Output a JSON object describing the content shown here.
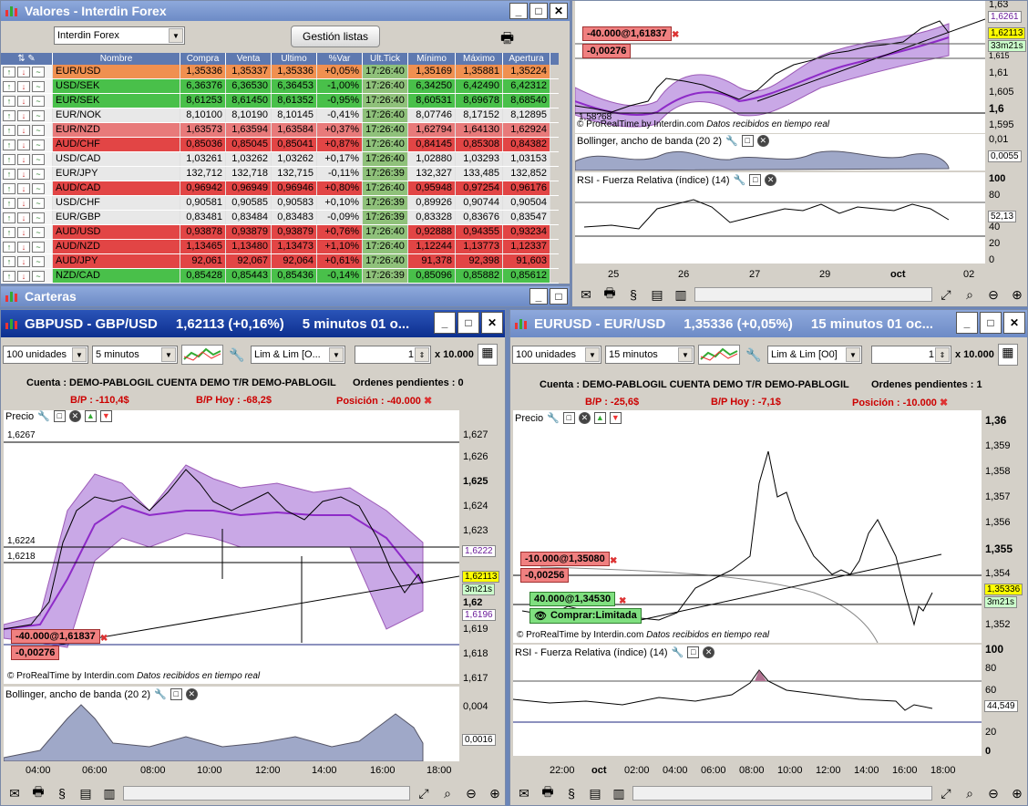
{
  "valores": {
    "title": "Valores - Interdin Forex",
    "list_select": "Interdin Forex",
    "manage_lists": "Gestión listas",
    "columns": [
      "Nombre",
      "Compra",
      "Venta",
      "Ultimo",
      "%Var",
      "Ult.Tick",
      "Mínimo",
      "Máximo",
      "Apertura"
    ],
    "rows": [
      {
        "name": "EUR/USD",
        "compra": "1,35336",
        "venta": "1,35337",
        "ultimo": "1,35336",
        "var": "+0,05%",
        "tick": "17:26:40",
        "min": "1,35169",
        "max": "1,35881",
        "ap": "1,35224",
        "color": "orange"
      },
      {
        "name": "USD/SEK",
        "compra": "6,36376",
        "venta": "6,36530",
        "ultimo": "6,36453",
        "var": "-1,00%",
        "tick": "17:26:40",
        "min": "6,34250",
        "max": "6,42490",
        "ap": "6,42312",
        "color": "green"
      },
      {
        "name": "EUR/SEK",
        "compra": "8,61253",
        "venta": "8,61450",
        "ultimo": "8,61352",
        "var": "-0,95%",
        "tick": "17:26:40",
        "min": "8,60531",
        "max": "8,69678",
        "ap": "8,68540",
        "color": "green"
      },
      {
        "name": "EUR/NOK",
        "compra": "8,10100",
        "venta": "8,10190",
        "ultimo": "8,10145",
        "var": "-0,41%",
        "tick": "17:26:40",
        "min": "8,07746",
        "max": "8,17152",
        "ap": "8,12895",
        "color": "light"
      },
      {
        "name": "EUR/NZD",
        "compra": "1,63573",
        "venta": "1,63594",
        "ultimo": "1,63584",
        "var": "+0,37%",
        "tick": "17:26:40",
        "min": "1,62794",
        "max": "1,64130",
        "ap": "1,62924",
        "color": "pink"
      },
      {
        "name": "AUD/CHF",
        "compra": "0,85036",
        "venta": "0,85045",
        "ultimo": "0,85041",
        "var": "+0,87%",
        "tick": "17:26:40",
        "min": "0,84145",
        "max": "0,85308",
        "ap": "0,84382",
        "color": "red"
      },
      {
        "name": "USD/CAD",
        "compra": "1,03261",
        "venta": "1,03262",
        "ultimo": "1,03262",
        "var": "+0,17%",
        "tick": "17:26:40",
        "min": "1,02880",
        "max": "1,03293",
        "ap": "1,03153",
        "color": "light"
      },
      {
        "name": "EUR/JPY",
        "compra": "132,712",
        "venta": "132,718",
        "ultimo": "132,715",
        "var": "-0,11%",
        "tick": "17:26:39",
        "min": "132,327",
        "max": "133,485",
        "ap": "132,852",
        "color": "light"
      },
      {
        "name": "AUD/CAD",
        "compra": "0,96942",
        "venta": "0,96949",
        "ultimo": "0,96946",
        "var": "+0,80%",
        "tick": "17:26:40",
        "min": "0,95948",
        "max": "0,97254",
        "ap": "0,96176",
        "color": "red"
      },
      {
        "name": "USD/CHF",
        "compra": "0,90581",
        "venta": "0,90585",
        "ultimo": "0,90583",
        "var": "+0,10%",
        "tick": "17:26:39",
        "min": "0,89926",
        "max": "0,90744",
        "ap": "0,90504",
        "color": "light"
      },
      {
        "name": "EUR/GBP",
        "compra": "0,83481",
        "venta": "0,83484",
        "ultimo": "0,83483",
        "var": "-0,09%",
        "tick": "17:26:39",
        "min": "0,83328",
        "max": "0,83676",
        "ap": "0,83547",
        "color": "light"
      },
      {
        "name": "AUD/USD",
        "compra": "0,93878",
        "venta": "0,93879",
        "ultimo": "0,93879",
        "var": "+0,76%",
        "tick": "17:26:40",
        "min": "0,92888",
        "max": "0,94355",
        "ap": "0,93234",
        "color": "red"
      },
      {
        "name": "AUD/NZD",
        "compra": "1,13465",
        "venta": "1,13480",
        "ultimo": "1,13473",
        "var": "+1,10%",
        "tick": "17:26:40",
        "min": "1,12244",
        "max": "1,13773",
        "ap": "1,12337",
        "color": "red"
      },
      {
        "name": "AUD/JPY",
        "compra": "92,061",
        "venta": "92,067",
        "ultimo": "92,064",
        "var": "+0,61%",
        "tick": "17:26:40",
        "min": "91,378",
        "max": "92,398",
        "ap": "91,603",
        "color": "red"
      },
      {
        "name": "NZD/CAD",
        "compra": "0,85428",
        "venta": "0,85443",
        "ultimo": "0,85436",
        "var": "-0,14%",
        "tick": "17:26:39",
        "min": "0,85096",
        "max": "0,85882",
        "ap": "0,85612",
        "color": "green"
      }
    ]
  },
  "carteras": {
    "title": "Carteras"
  },
  "topchart": {
    "order_label": "-40.000@1,61837",
    "order_value": "-0,00276",
    "prices": [
      "1,63",
      "1,6261",
      "1,62113",
      "33m21s",
      "1,615",
      "1,61",
      "1,605",
      "1,6",
      "1,595",
      "0,01",
      "0,0055",
      "100",
      "80",
      "52,13",
      "40",
      "20",
      "0"
    ],
    "credit": "© ProRealTime by Interdin.com",
    "received": "Datos recibidos en tiempo real",
    "boll_label": "Bollinger, ancho de banda (20 2)",
    "rsi_label": "RSI - Fuerza Relativa (índice) (14)",
    "xlabels": [
      "25",
      "26",
      "27",
      "29",
      "oct",
      "02"
    ],
    "low_label": "1,58?68"
  },
  "gbp": {
    "title": "GBPUSD - GBP/USD",
    "price": "1,62113 (+0,16%)",
    "period": "5 minutos  01 o...",
    "units": "100 unidades",
    "interval": "5 minutos",
    "mode": "Lim & Lim [O...",
    "qty": "1",
    "mult": "x 10.000",
    "account": "Cuenta : DEMO-PABLOGIL CUENTA DEMO T/R DEMO-PABLOGIL",
    "pending": "Ordenes pendientes : 0",
    "bp": "B/P : -110,4$",
    "bp_today": "B/P Hoy : -68,2$",
    "position": "Posición : -40.000",
    "price_label": "Precio",
    "yaxis": [
      "1,627",
      "1,626",
      "1,625",
      "1,624",
      "1,623",
      "1,6222",
      "1,62113",
      "3m21s",
      "1,62",
      "1,6196",
      "1,619",
      "1,618",
      "1,617"
    ],
    "hl": [
      "1,6267",
      "1,6224",
      "1,6218"
    ],
    "order_label": "-40.000@1,61837",
    "order_value": "-0,00276",
    "credit": "© ProRealTime by Interdin.com",
    "received": "Datos recibidos en tiempo real",
    "boll_label": "Bollinger, ancho de banda (20 2)",
    "boll_axis": [
      "0,004",
      "0,0016"
    ],
    "xlabels": [
      "04:00",
      "06:00",
      "08:00",
      "10:00",
      "12:00",
      "14:00",
      "16:00",
      "18:00"
    ]
  },
  "eur": {
    "title": "EURUSD - EUR/USD",
    "price": "1,35336 (+0,05%)",
    "period": "15 minutos  01 oc...",
    "units": "100 unidades",
    "interval": "15 minutos",
    "mode": "Lim & Lim [O0]",
    "qty": "1",
    "mult": "x 10.000",
    "account": "Cuenta : DEMO-PABLOGIL CUENTA DEMO T/R DEMO-PABLOGIL",
    "pending": "Ordenes pendientes : 1",
    "bp": "B/P : -25,6$",
    "bp_today": "B/P Hoy : -7,1$",
    "position": "Posición : -10.000",
    "price_label": "Precio",
    "yaxis": [
      "1,36",
      "1,359",
      "1,358",
      "1,357",
      "1,356",
      "1,355",
      "1,354",
      "1,35336",
      "3m21s",
      "1,352"
    ],
    "order1": "-10.000@1,35080",
    "order1_value": "-0,00256",
    "order2": "40.000@1,34530",
    "order2_action": "Comprar:Limitada",
    "credit": "© ProRealTime by Interdin.com",
    "received": "Datos recibidos en tiempo real",
    "rsi_label": "RSI - Fuerza Relativa (índice) (14)",
    "rsi_axis": [
      "100",
      "80",
      "60",
      "44,549",
      "20",
      "0"
    ],
    "xlabels": [
      "22:00",
      "oct",
      "02:00",
      "04:00",
      "06:00",
      "08:00",
      "10:00",
      "12:00",
      "14:00",
      "16:00",
      "18:00"
    ]
  }
}
